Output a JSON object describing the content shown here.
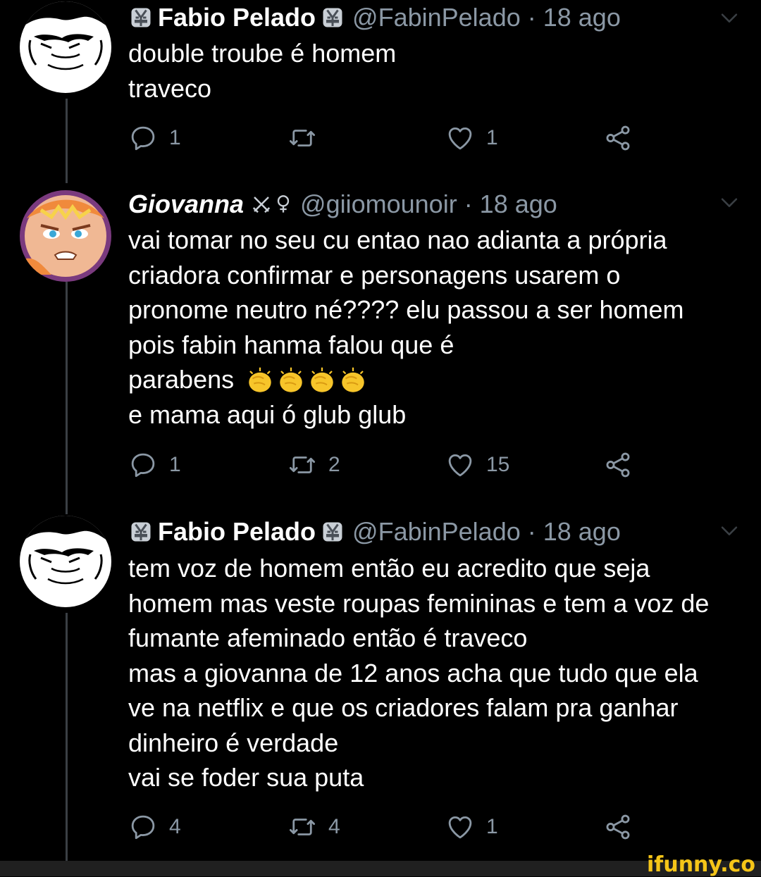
{
  "tweets": [
    {
      "name": "Fabio Pelado",
      "handle": "@FabinPelado · 18 ago",
      "lines": [
        "double troube é homem",
        "traveco"
      ],
      "replies": "1",
      "retweets": "",
      "likes": "1"
    },
    {
      "name": "Giovanna",
      "handle": "@giiomounoir · 18 ago",
      "lines": [
        "vai tomar no seu cu entao nao adianta a própria",
        "criadora confirmar e personagens usarem o",
        "pronome neutro  né???? elu passou a ser homem",
        "pois fabin hanma falou que é",
        "parabens",
        "e mama aqui ó glub glub"
      ],
      "replies": "1",
      "retweets": "2",
      "likes": "15"
    },
    {
      "name": "Fabio Pelado",
      "handle": "@FabinPelado · 18 ago",
      "lines": [
        "tem voz de homem então eu acredito que seja",
        "homem mas veste roupas femininas e tem a voz de",
        "fumante afeminado então é traveco",
        "mas a giovanna de 12 anos acha que tudo que ela",
        "ve na  netflix e que os criadores falam pra ganhar",
        "dinheiro é verdade",
        "vai se foder sua puta"
      ],
      "replies": "4",
      "retweets": "4",
      "likes": "1"
    }
  ],
  "watermark": "ifunny.co",
  "icons": {
    "reply": "reply-icon",
    "retweet": "retweet-icon",
    "like": "heart-icon",
    "share": "share-icon",
    "caret": "chevron-down-icon"
  },
  "colors": {
    "background": "#000000",
    "text": "#ffffff",
    "secondary": "#8b98a5",
    "watermark": "#f5c518"
  }
}
